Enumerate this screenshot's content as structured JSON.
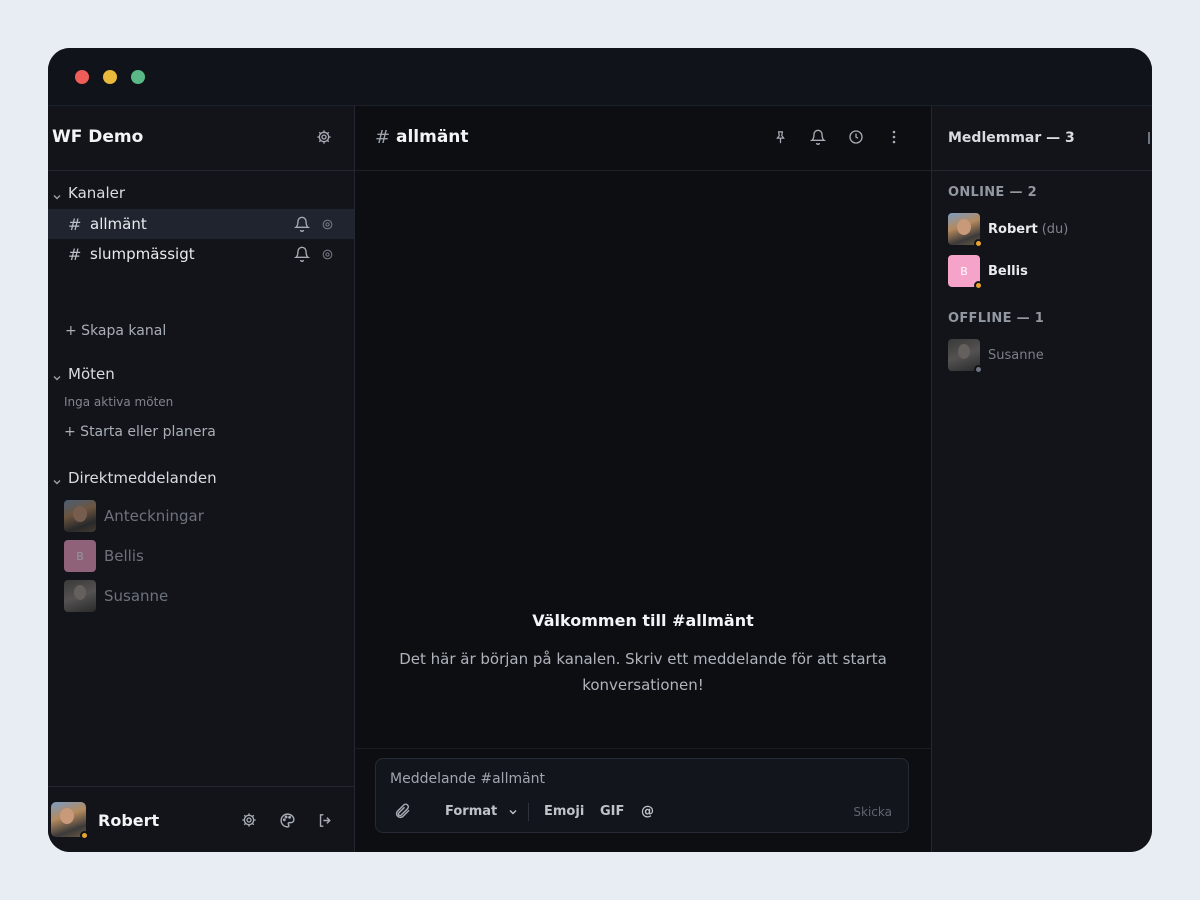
{
  "window": {
    "controls": [
      "close",
      "minimize",
      "maximize"
    ],
    "colors": {
      "close": "#ee5d58",
      "minimize": "#e9b93b",
      "maximize": "#5ab887"
    }
  },
  "workspace": {
    "name": "WF Demo"
  },
  "sidebar": {
    "channels_section": "Kanaler",
    "channels": [
      {
        "hash": "#",
        "name": "allmänt",
        "active": true
      },
      {
        "hash": "#",
        "name": "slumpmässigt",
        "active": false
      }
    ],
    "create_channel": "+ Skapa kanal",
    "meetings_section": "Möten",
    "no_meetings": "Inga aktiva möten",
    "start_meeting": "+ Starta eller planera",
    "dm_section": "Direktmeddelanden",
    "dms": [
      {
        "name": "Anteckningar",
        "avatar": "photo"
      },
      {
        "name": "Bellis",
        "avatar": "letter",
        "letter": "B"
      },
      {
        "name": "Susanne",
        "avatar": "photo"
      }
    ]
  },
  "user_bar": {
    "name": "Robert",
    "icons": [
      "gear-icon",
      "palette-icon",
      "logout-icon"
    ]
  },
  "channel_header": {
    "hash": "#",
    "title": "allmänt",
    "icons": [
      "pin-icon",
      "bell-icon",
      "history-icon",
      "more-icon"
    ]
  },
  "welcome": {
    "title": "Välkommen till #allmänt",
    "text": "Det här är början på kanalen. Skriv ett meddelande för att starta konversationen!"
  },
  "composer": {
    "placeholder": "Meddelande #allmänt",
    "format": "Format",
    "emoji": "Emoji",
    "gif": "GIF",
    "mention": "@",
    "send": "Skicka"
  },
  "members": {
    "title": "Medlemmar — 3",
    "online_label": "ONLINE — 2",
    "offline_label": "OFFLINE — 1",
    "online": [
      {
        "name": "Robert",
        "suffix": "(du)",
        "status": "away"
      },
      {
        "name": "Bellis",
        "suffix": "",
        "status": "away",
        "letter": "B"
      }
    ],
    "offline": [
      {
        "name": "Susanne",
        "suffix": "",
        "status": "offline"
      }
    ],
    "status_colors": {
      "away": "#e6a531",
      "offline": "#6f7580"
    }
  }
}
